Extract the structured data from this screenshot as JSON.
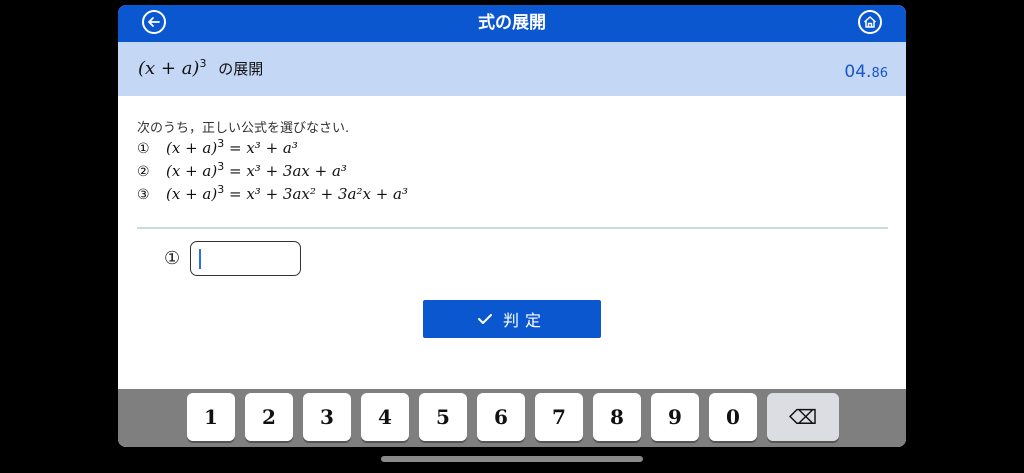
{
  "header": {
    "title": "式の展開",
    "back_icon": "back-arrow-icon",
    "home_icon": "home-icon"
  },
  "topic": {
    "expr_base": "(x + a)",
    "expr_exp": "3",
    "suffix": "の展開",
    "timer_main": "04.",
    "timer_small": "86"
  },
  "question": {
    "prompt": "次のうち，正しい公式を選びなさい.",
    "options": [
      {
        "number": "①",
        "lhs": "(x + a)",
        "lhs_exp": "3",
        "rhs": "= x³ + a³"
      },
      {
        "number": "②",
        "lhs": "(x + a)",
        "lhs_exp": "3",
        "rhs": "= x³ + 3ax + a³"
      },
      {
        "number": "③",
        "lhs": "(x + a)",
        "lhs_exp": "3",
        "rhs": "= x³ + 3ax² + 3a²x + a³"
      }
    ]
  },
  "answer": {
    "number": "①",
    "value": ""
  },
  "judge_button": {
    "label": "判定",
    "icon": "checkmark-icon"
  },
  "keypad": {
    "keys": [
      "1",
      "2",
      "3",
      "4",
      "5",
      "6",
      "7",
      "8",
      "9",
      "0"
    ],
    "delete": "⌫"
  },
  "colors": {
    "primary": "#0b57d0",
    "subbar": "#c4d7f5",
    "timer": "#1a56c8",
    "keyboard_bg": "#7f7f7f"
  }
}
